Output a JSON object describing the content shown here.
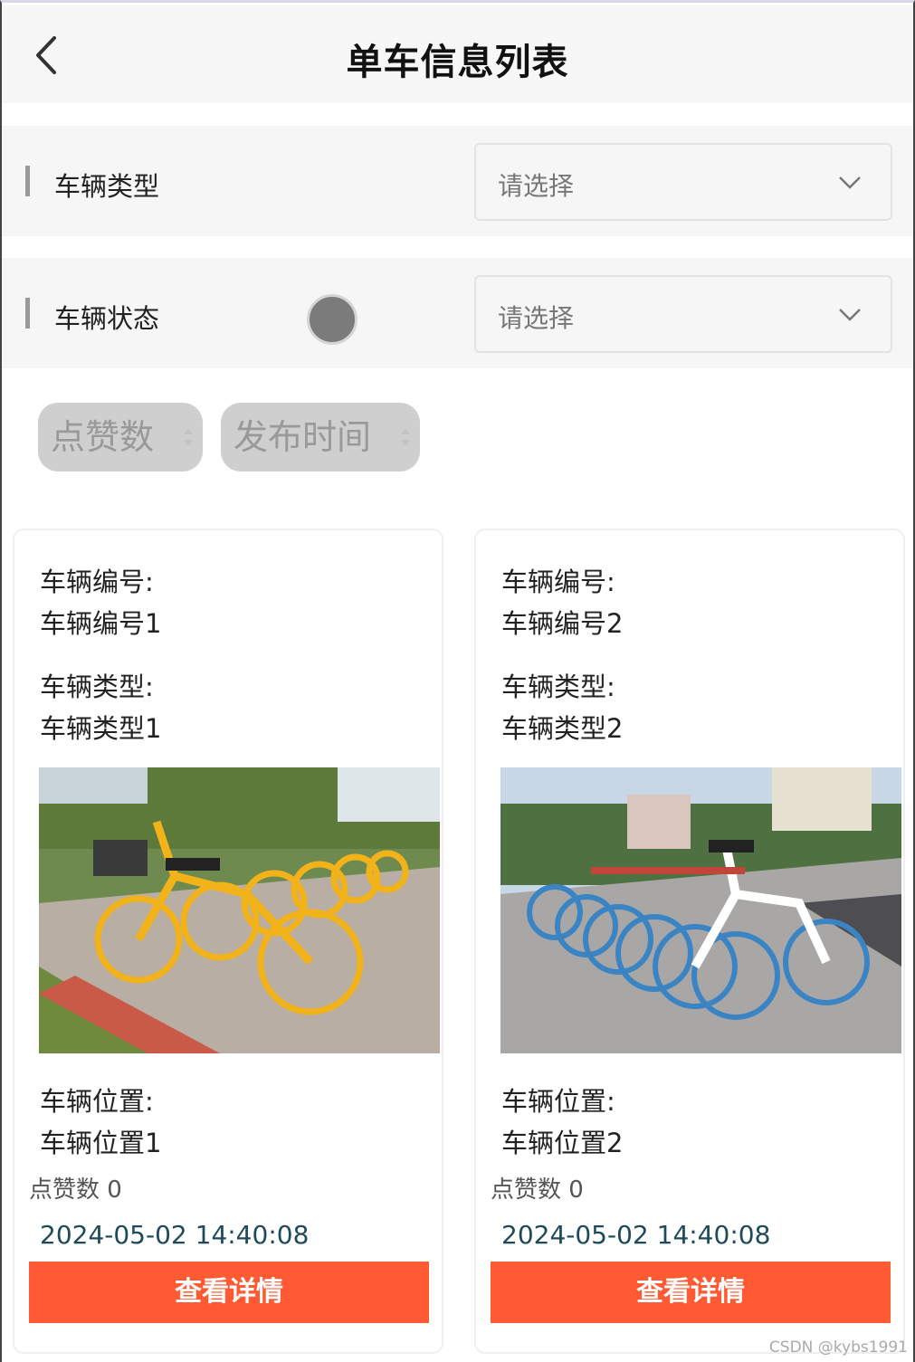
{
  "header": {
    "title": "单车信息列表",
    "back_icon": "chevron-left-icon"
  },
  "filters": [
    {
      "label": "车辆类型",
      "placeholder": "请选择"
    },
    {
      "label": "车辆状态",
      "placeholder": "请选择"
    }
  ],
  "sort_buttons": [
    {
      "label": "点赞数"
    },
    {
      "label": "发布时间"
    }
  ],
  "cards": [
    {
      "number_label": "车辆编号:",
      "number_value": "车辆编号1",
      "type_label": "车辆类型:",
      "type_value": "车辆类型1",
      "location_label": "车辆位置:",
      "location_value": "车辆位置1",
      "likes": "点赞数 0",
      "date": "2024-05-02 14:40:08",
      "button": "查看详情"
    },
    {
      "number_label": "车辆编号:",
      "number_value": "车辆编号2",
      "type_label": "车辆类型:",
      "type_value": "车辆类型2",
      "location_label": "车辆位置:",
      "location_value": "车辆位置2",
      "likes": "点赞数 0",
      "date": "2024-05-02 14:40:08",
      "button": "查看详情"
    }
  ],
  "colors": {
    "accent": "#ff5a33",
    "date_text": "#1e4a5a"
  },
  "watermark": "CSDN @kybs1991"
}
